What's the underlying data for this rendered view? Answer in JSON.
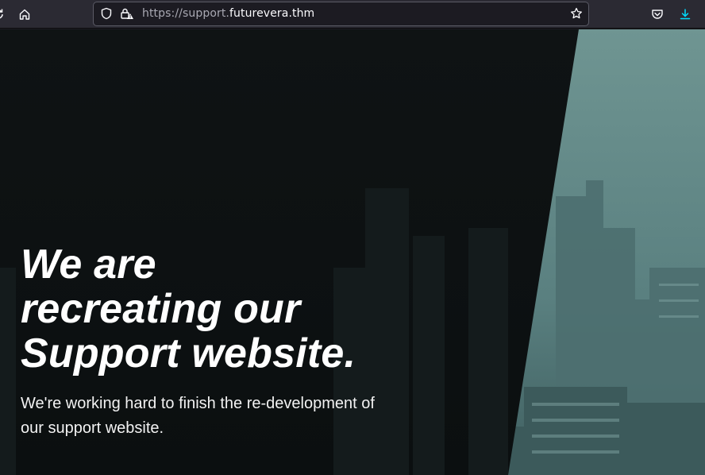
{
  "browser": {
    "url_prefix": "https://support.",
    "url_domain": "futurevera.thm",
    "icons": [
      "reload-icon",
      "home-icon",
      "shield-icon",
      "lock-warning-icon",
      "bookmark-star-icon",
      "pocket-icon",
      "downloads-icon"
    ]
  },
  "hero": {
    "title_line1": "We are",
    "title_line2": "recreating our",
    "title_line3": "Support website.",
    "subtitle": "We're working hard to finish the re-development of our support website."
  },
  "colors": {
    "toolbar": "#2b2a33",
    "urlbar": "#1c1b22",
    "accent_download": "#0df",
    "hero_text": "#ffffff",
    "overlay_dark": "#0d1112",
    "city_teal": "#5d8383"
  }
}
